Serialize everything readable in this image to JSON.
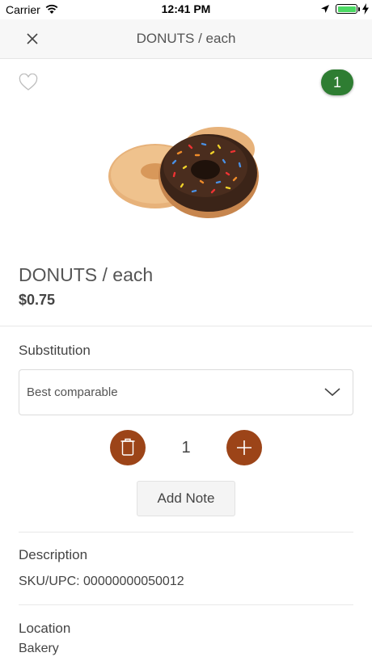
{
  "status_bar": {
    "carrier": "Carrier",
    "time": "12:41 PM"
  },
  "nav": {
    "title": "DONUTS / each",
    "close_icon": "close-icon"
  },
  "cart": {
    "count": "1"
  },
  "product": {
    "name": "DONUTS / each",
    "price": "$0.75",
    "image": "donut-image"
  },
  "substitution": {
    "label": "Substitution",
    "selected": "Best comparable"
  },
  "quantity": {
    "value": "1"
  },
  "note": {
    "label": "Add Note"
  },
  "description": {
    "label": "Description",
    "sku_label": "SKU/UPC:",
    "sku": "00000000050012"
  },
  "location": {
    "label": "Location",
    "value": "Bakery"
  },
  "colors": {
    "accent": "#9c4418",
    "badge": "#2e7d32"
  }
}
